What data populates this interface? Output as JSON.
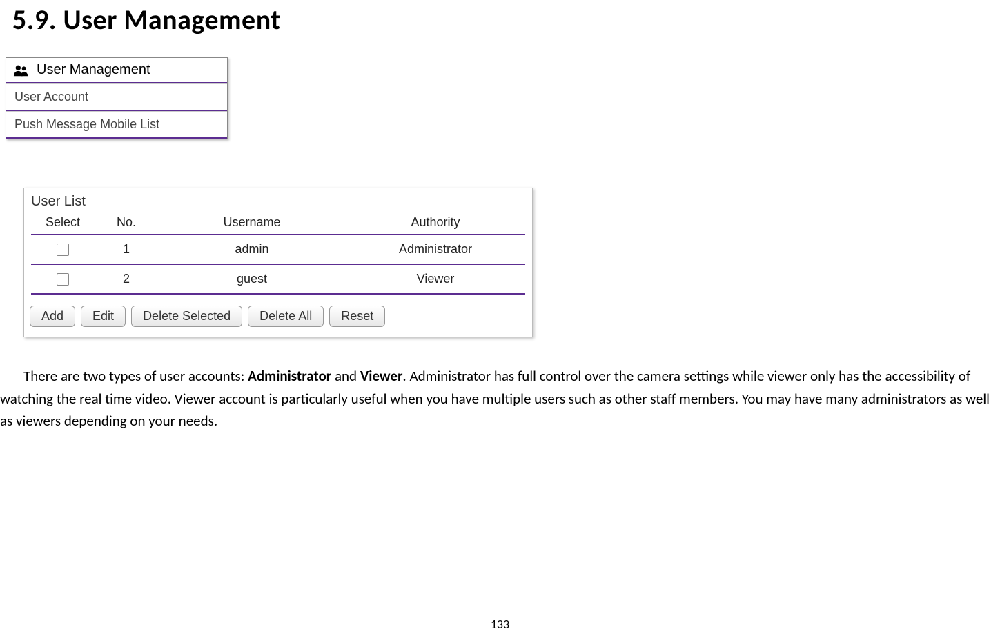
{
  "heading": "5.9.    User Management",
  "nav": {
    "title": "User Management",
    "items": [
      "User Account",
      "Push Message Mobile List"
    ]
  },
  "panel": {
    "title": "User List",
    "columns": [
      "Select",
      "No.",
      "Username",
      "Authority"
    ],
    "rows": [
      {
        "no": "1",
        "username": "admin",
        "authority": "Administrator"
      },
      {
        "no": "2",
        "username": "guest",
        "authority": "Viewer"
      }
    ],
    "buttons": {
      "add": "Add",
      "edit": "Edit",
      "delete_selected": "Delete Selected",
      "delete_all": "Delete All",
      "reset": "Reset"
    }
  },
  "paragraph": {
    "pre": "There are two types of user accounts: ",
    "b1": "Administrator",
    "mid1": " and ",
    "b2": "Viewer",
    "post": ". Administrator has full control over the camera settings while viewer only has the accessibility of watching the real time video. Viewer account is particularly useful when you have multiple users such as other staff members. You may have many administrators as well as viewers depending on your needs."
  },
  "page_number": "133"
}
